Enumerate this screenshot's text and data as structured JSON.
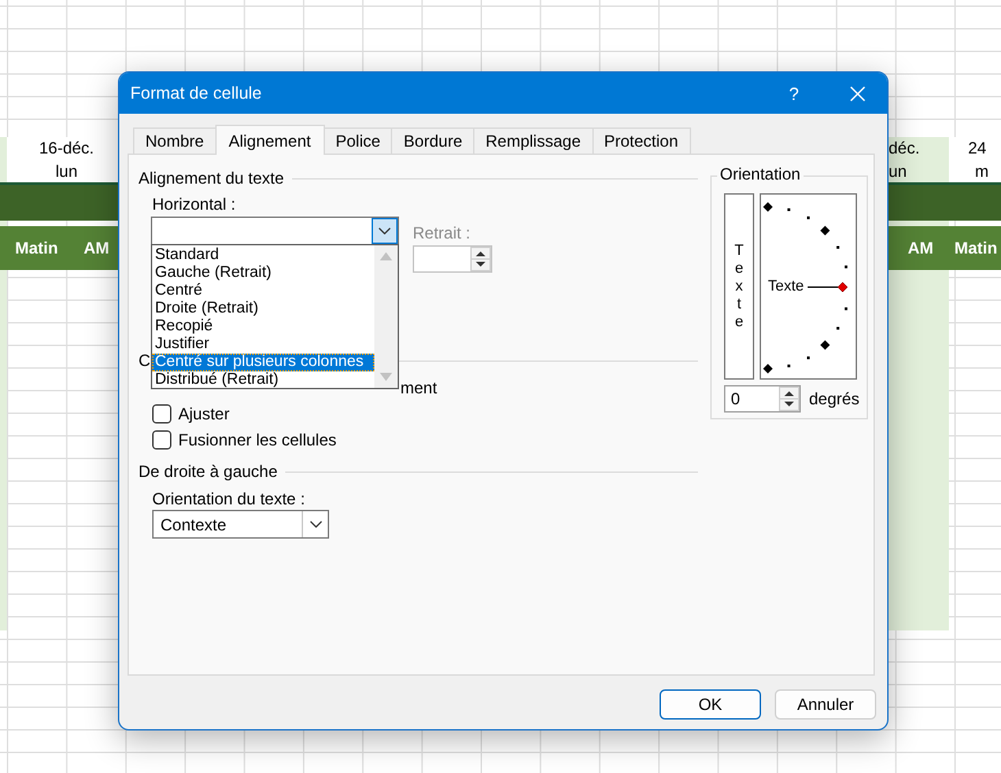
{
  "spreadsheet": {
    "left": {
      "date": "16-déc.",
      "day": "lun",
      "headers": [
        "Matin",
        "AM"
      ]
    },
    "right": {
      "date": "déc.",
      "day": "un",
      "next_date": "24",
      "next_day": "m",
      "headers": [
        "AM",
        "Matin"
      ]
    }
  },
  "window": {
    "title": "Format de cellule",
    "help": "?"
  },
  "tabs": [
    {
      "label": "Nombre",
      "selected": false
    },
    {
      "label": "Alignement",
      "selected": true
    },
    {
      "label": "Police",
      "selected": false
    },
    {
      "label": "Bordure",
      "selected": false
    },
    {
      "label": "Remplissage",
      "selected": false
    },
    {
      "label": "Protection",
      "selected": false
    }
  ],
  "text_alignment": {
    "title": "Alignement du texte",
    "horizontal_label": "Horizontal :",
    "indent": {
      "label": "Retrait :",
      "disabled": true
    }
  },
  "horizontal_dropdown": [
    {
      "label": "Standard",
      "selected": false
    },
    {
      "label": "Gauche (Retrait)",
      "selected": false
    },
    {
      "label": "Centré",
      "selected": false
    },
    {
      "label": "Droite (Retrait)",
      "selected": false
    },
    {
      "label": "Recopié",
      "selected": false
    },
    {
      "label": "Justifier",
      "selected": false
    },
    {
      "label": "Centré sur plusieurs colonnes",
      "selected": true
    },
    {
      "label": "Distribué (Retrait)",
      "selected": false
    }
  ],
  "text_control": {
    "title": "C",
    "wrap_fragment": "ment",
    "options": [
      {
        "label": "Ajuster",
        "checked": false
      },
      {
        "label": "Fusionner les cellules",
        "checked": false
      }
    ]
  },
  "right_to_left": {
    "title": "De droite à gauche",
    "label": "Orientation du texte :",
    "value": "Contexte"
  },
  "orientation": {
    "title": "Orientation",
    "vertical_text": "Texte",
    "dial_text": "Texte",
    "degrees": "0",
    "degrees_label": "degrés"
  },
  "buttons": [
    {
      "label": "OK",
      "default": true
    },
    {
      "label": "Annuler",
      "default": false
    }
  ]
}
